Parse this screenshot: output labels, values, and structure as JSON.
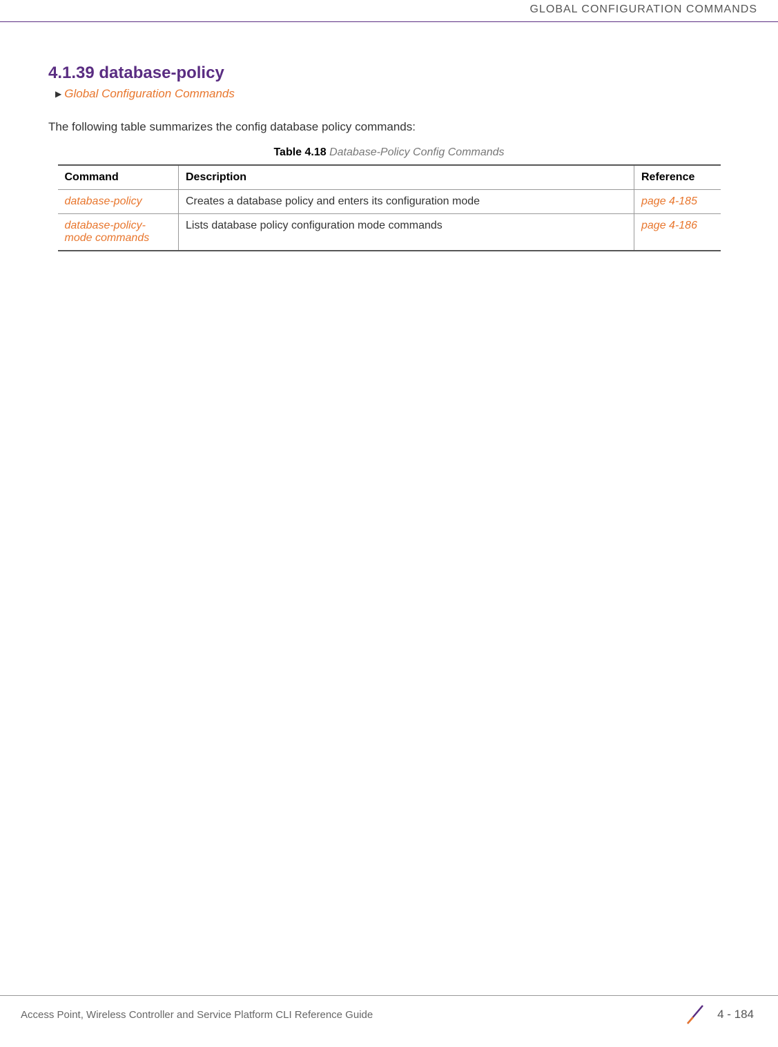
{
  "header": {
    "running_head": "GLOBAL CONFIGURATION COMMANDS"
  },
  "section": {
    "heading": "4.1.39 database-policy",
    "sublink": "Global Configuration Commands",
    "intro": "The following table summarizes the config database policy commands:"
  },
  "table": {
    "caption_label": "Table 4.18",
    "caption_title": "Database-Policy Config Commands",
    "headers": {
      "command": "Command",
      "description": "Description",
      "reference": "Reference"
    },
    "rows": [
      {
        "command": "database-policy",
        "description": "Creates a database policy and enters its configuration mode",
        "reference": "page 4-185"
      },
      {
        "command": "database-policy-mode commands",
        "description": "Lists database policy configuration mode commands",
        "reference": "page 4-186"
      }
    ]
  },
  "footer": {
    "guide_title": "Access Point, Wireless Controller and Service Platform CLI Reference Guide",
    "page_number": "4 - 184"
  }
}
